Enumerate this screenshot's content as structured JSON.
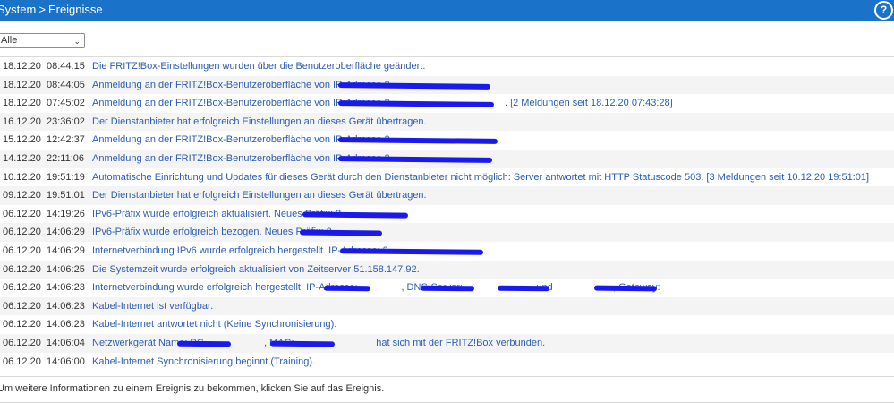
{
  "header": {
    "breadcrumb": [
      "System",
      "Ereignisse"
    ],
    "separator": ">",
    "help_label": "?"
  },
  "filter": {
    "selected": "Alle"
  },
  "log": [
    {
      "date": "18.12.20",
      "time": "08:44:15",
      "message": "Die FRITZ!Box-Einstellungen wurden über die Benutzeroberfläche geändert."
    },
    {
      "date": "18.12.20",
      "time": "08:44:05",
      "message": "Anmeldung an der FRITZ!Box-Benutzeroberfläche von IP-Adresse 2"
    },
    {
      "date": "18.12.20",
      "time": "07:45:02",
      "message": "Anmeldung an der FRITZ!Box-Benutzeroberfläche von IP-Adresse 2                                          . [2 Meldungen seit 18.12.20 07:43:28]"
    },
    {
      "date": "16.12.20",
      "time": "23:36:02",
      "message": "Der Dienstanbieter hat erfolgreich Einstellungen an dieses Gerät übertragen."
    },
    {
      "date": "15.12.20",
      "time": "12:42:37",
      "message": "Anmeldung an der FRITZ!Box-Benutzeroberfläche von IP-Adresse 2"
    },
    {
      "date": "14.12.20",
      "time": "22:11:06",
      "message": "Anmeldung an der FRITZ!Box-Benutzeroberfläche von IP-Adresse 2"
    },
    {
      "date": "10.12.20",
      "time": "19:51:19",
      "message": "Automatische Einrichtung und Updates für dieses Gerät durch den Dienstanbieter nicht möglich: Server antwortet mit HTTP Statuscode 503. [3 Meldungen seit 10.12.20 19:51:01]"
    },
    {
      "date": "09.12.20",
      "time": "19:51:01",
      "message": "Der Dienstanbieter hat erfolgreich Einstellungen an dieses Gerät übertragen."
    },
    {
      "date": "06.12.20",
      "time": "14:19:26",
      "message": "IPv6-Präfix wurde erfolgreich aktualisiert. Neues Präfix: 2"
    },
    {
      "date": "06.12.20",
      "time": "14:06:29",
      "message": "IPv6-Präfix wurde erfolgreich bezogen. Neues Präfix: 2"
    },
    {
      "date": "06.12.20",
      "time": "14:06:29",
      "message": "Internetverbindung IPv6 wurde erfolgreich hergestellt. IP-Adresse: 2"
    },
    {
      "date": "06.12.20",
      "time": "14:06:25",
      "message": "Die Systemzeit wurde erfolgreich aktualisiert von Zeitserver 51.158.147.92."
    },
    {
      "date": "06.12.20",
      "time": "14:06:23",
      "message": "Internetverbindung wurde erfolgreich hergestellt. IP-Adresse:                , DNS-Server:                           und                      , Gateway:"
    },
    {
      "date": "06.12.20",
      "time": "14:06:23",
      "message": "Kabel-Internet ist verfügbar."
    },
    {
      "date": "06.12.20",
      "time": "14:06:23",
      "message": "Kabel-Internet antwortet nicht (Keine Synchronisierung)."
    },
    {
      "date": "06.12.20",
      "time": "14:06:04",
      "message": "Netzwerkgerät Name: PC                      , MAC:                              hat sich mit der FRITZ!Box verbunden."
    },
    {
      "date": "06.12.20",
      "time": "14:06:00",
      "message": "Kabel-Internet Synchronisierung beginnt (Training)."
    }
  ],
  "footer": {
    "hint": "Um weitere Informationen zu einem Ereignis zu bekommen, klicken Sie auf das Ereignis."
  },
  "colors": {
    "header_bg": "#1a73c9",
    "message_link": "#2c5db3",
    "redaction": "#1a1aee"
  }
}
